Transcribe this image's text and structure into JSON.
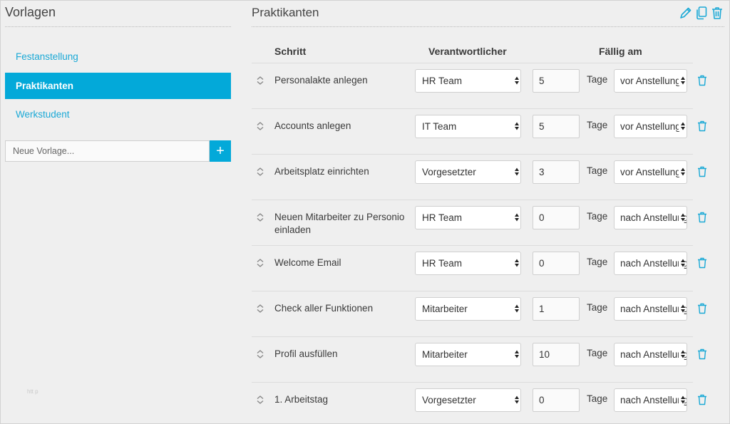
{
  "sidebar": {
    "title": "Vorlagen",
    "items": [
      {
        "label": "Festanstellung",
        "active": false
      },
      {
        "label": "Praktikanten",
        "active": true
      },
      {
        "label": "Werkstudent",
        "active": false
      }
    ],
    "new_template_placeholder": "Neue Vorlage...",
    "add_button_label": "+",
    "footer_text": "htt p"
  },
  "main": {
    "title": "Praktikanten",
    "toolbar_icons": [
      "pencil-icon",
      "copy-icon",
      "trash-icon"
    ],
    "columns": {
      "step": "Schritt",
      "responsible": "Verantwortlicher",
      "due": "Fällig am"
    },
    "days_label": "Tage",
    "rows": [
      {
        "step": "Personalakte anlegen",
        "responsible": "HR Team",
        "days": "5",
        "when": "vor Anstellung"
      },
      {
        "step": "Accounts anlegen",
        "responsible": "IT Team",
        "days": "5",
        "when": "vor Anstellung"
      },
      {
        "step": "Arbeitsplatz einrichten",
        "responsible": "Vorgesetzter",
        "days": "3",
        "when": "vor Anstellung"
      },
      {
        "step": "Neuen Mitarbeiter zu Personio einladen",
        "responsible": "HR Team",
        "days": "0",
        "when": "nach Anstellung"
      },
      {
        "step": "Welcome Email",
        "responsible": "HR Team",
        "days": "0",
        "when": "nach Anstellung"
      },
      {
        "step": "Check aller Funktionen",
        "responsible": "Mitarbeiter",
        "days": "1",
        "when": "nach Anstellung"
      },
      {
        "step": "Profil ausfüllen",
        "responsible": "Mitarbeiter",
        "days": "10",
        "when": "nach Anstellung"
      },
      {
        "step": "1. Arbeitstag",
        "responsible": "Vorgesetzter",
        "days": "0",
        "when": "nach Anstellung"
      }
    ]
  },
  "colors": {
    "accent": "#03a9d9",
    "background": "#efefef"
  }
}
